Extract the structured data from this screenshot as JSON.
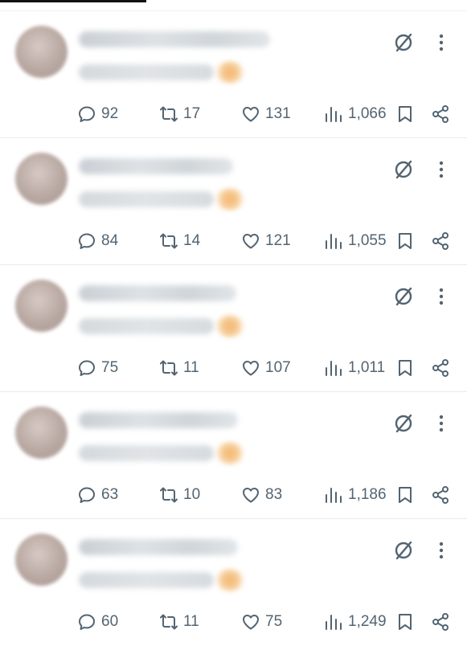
{
  "posts": [
    {
      "reply_count": "92",
      "retweet_count": "17",
      "like_count": "131",
      "view_count": "1,066"
    },
    {
      "reply_count": "84",
      "retweet_count": "14",
      "like_count": "121",
      "view_count": "1,055"
    },
    {
      "reply_count": "75",
      "retweet_count": "11",
      "like_count": "107",
      "view_count": "1,011"
    },
    {
      "reply_count": "63",
      "retweet_count": "10",
      "like_count": "83",
      "view_count": "1,186"
    },
    {
      "reply_count": "60",
      "retweet_count": "11",
      "like_count": "75",
      "view_count": "1,249"
    }
  ],
  "icons": {
    "reply": "reply-icon",
    "retweet": "retweet-icon",
    "like": "heart-icon",
    "views": "analytics-icon",
    "bookmark": "bookmark-icon",
    "share": "share-icon",
    "grok": "grok-icon",
    "more": "more-icon"
  },
  "colors": {
    "icon": "#536471",
    "divider": "#eff3f4"
  }
}
